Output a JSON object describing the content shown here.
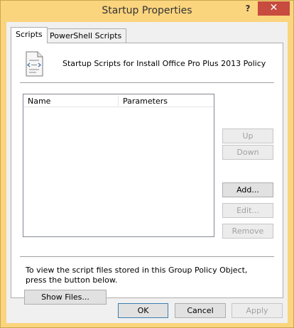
{
  "window": {
    "title": "Startup Properties",
    "help_label": "?",
    "close_label": "✕"
  },
  "tabs": [
    {
      "label": "Scripts",
      "active": true
    },
    {
      "label": "PowerShell Scripts",
      "active": false
    }
  ],
  "scripts_tab": {
    "heading": "Startup Scripts for Install Office Pro Plus 2013 Policy",
    "icon": "script-file-icon",
    "list": {
      "columns": [
        "Name",
        "Parameters"
      ],
      "rows": []
    },
    "buttons": {
      "up": "Up",
      "down": "Down",
      "add": "Add...",
      "edit": "Edit...",
      "remove": "Remove"
    },
    "info_text": "To view the script files stored in this Group Policy Object, press the button below.",
    "show_files": "Show Files..."
  },
  "footer": {
    "ok": "OK",
    "cancel": "Cancel",
    "apply": "Apply"
  }
}
